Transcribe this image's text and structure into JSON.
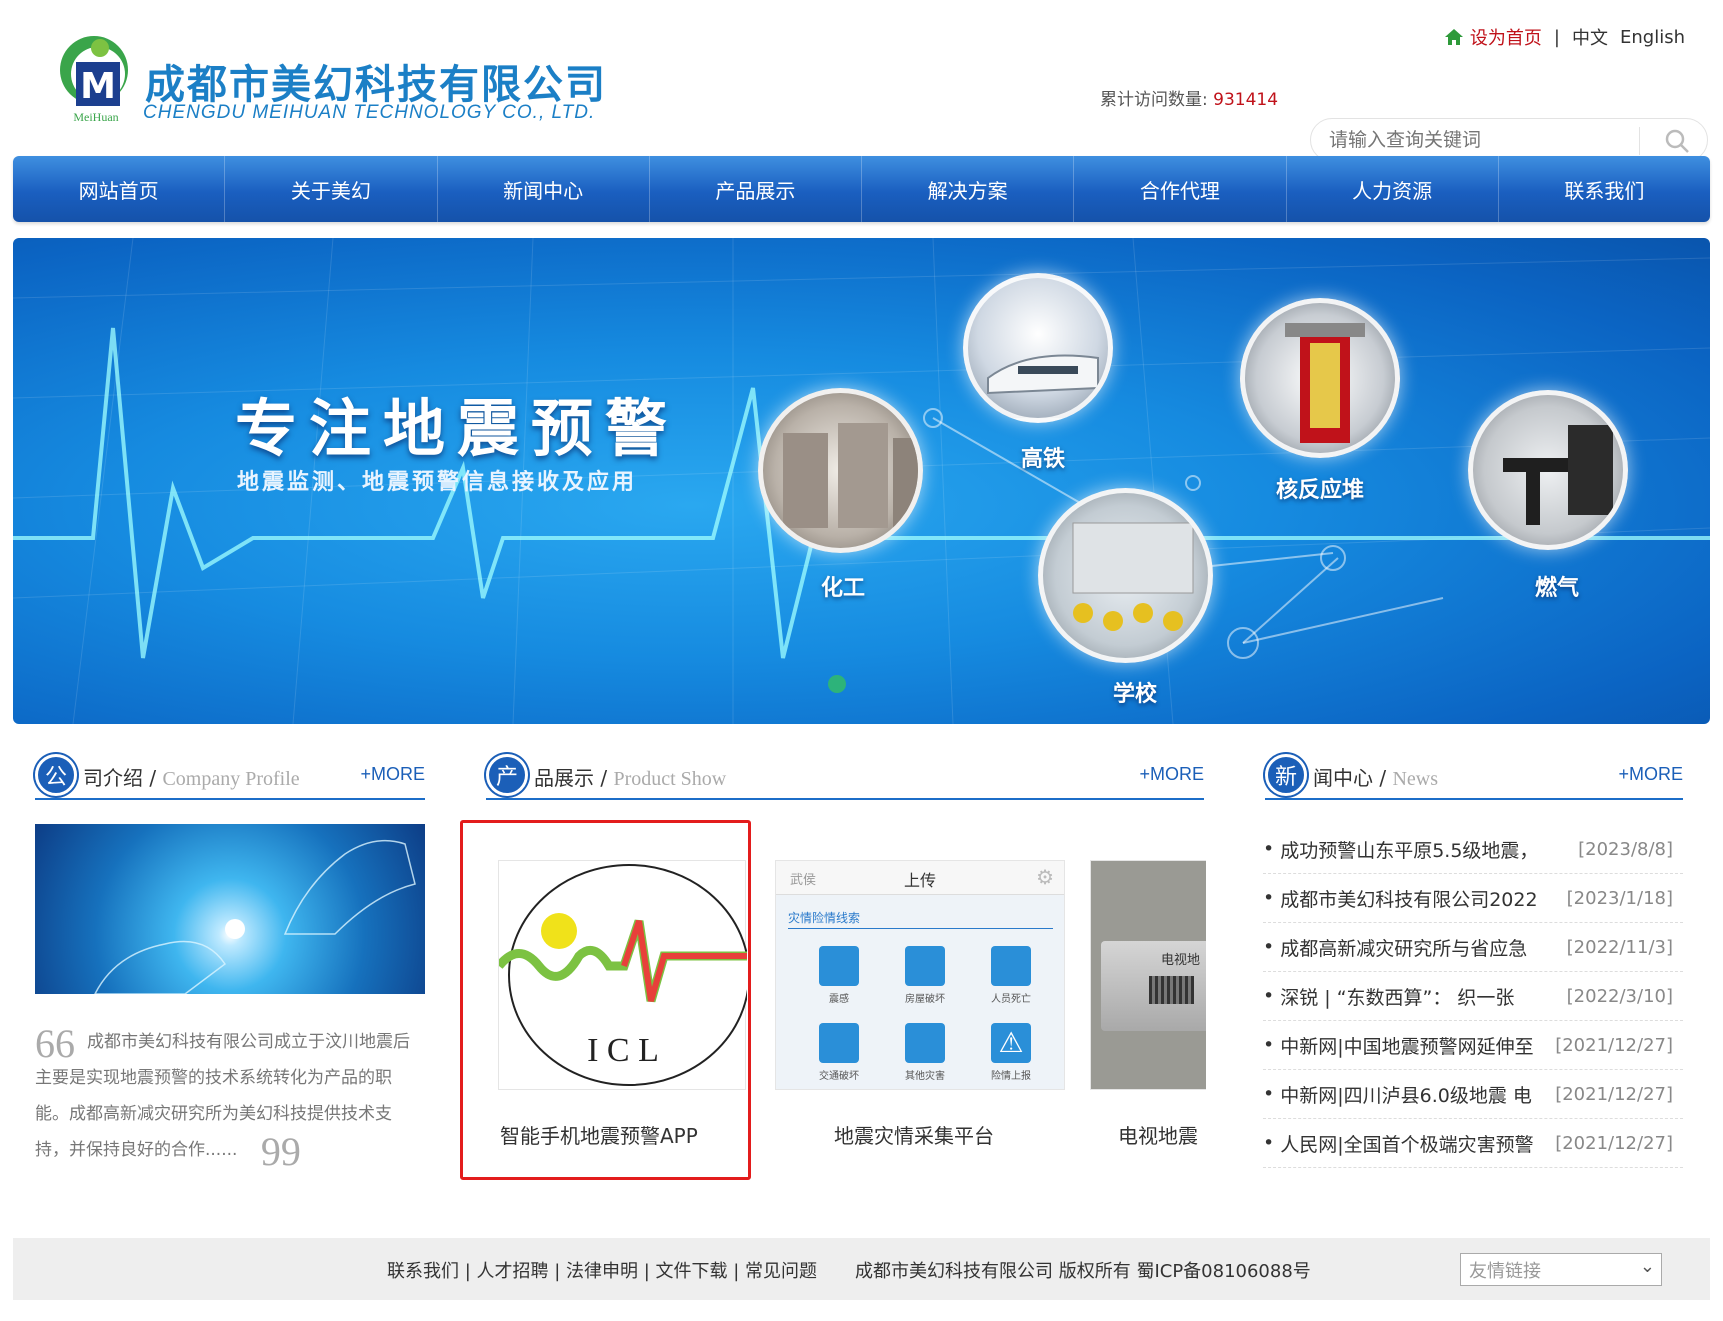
{
  "header": {
    "company_cn": "成都市美幻科技有限公司",
    "company_en": "CHENGDU MEIHUAN TECHNOLOGY CO., LTD.",
    "logo_text": "MeiHuan",
    "set_home": "设为首页",
    "divider": "|",
    "lang_cn": "中文",
    "lang_en": "English",
    "visits_label": "累计访问数量:",
    "visits_value": "931414",
    "search_placeholder": "请输入查询关键词"
  },
  "nav": [
    "网站首页",
    "关于美幻",
    "新闻中心",
    "产品展示",
    "解决方案",
    "合作代理",
    "人力资源",
    "联系我们"
  ],
  "banner": {
    "title": "专注地震预警",
    "subtitle": "地震监测、地震预警信息接收及应用",
    "bubbles": [
      "高铁",
      "核反应堆",
      "化工",
      "学校",
      "燃气"
    ]
  },
  "company": {
    "head_char": "公",
    "title": "司介绍",
    "slash": " / ",
    "title_en": "Company Profile",
    "more": "+MORE",
    "quote_open": "66",
    "quote_close": "99",
    "text": "成都市美幻科技有限公司成立于汶川地震后主要是实现地震预警的技术系统转化为产品的职能。成都高新减灾研究所为美幻科技提供技术支持，并保持良好的合作......"
  },
  "products": {
    "head_char": "产",
    "title": "品展示",
    "slash": " / ",
    "title_en": "Product Show",
    "more": "+MORE",
    "items": [
      {
        "label": "智能手机地震预警APP",
        "logo_letters": "I C L"
      },
      {
        "label": "地震灾情采集平台",
        "screen_title": "上传",
        "screen_left": "武侯",
        "screen_section": "灾情险情线索",
        "tiles": [
          "震感",
          "房屋破坏",
          "人员死亡",
          "交通破坏",
          "其他灾害",
          "险情上报"
        ]
      },
      {
        "label": "电视地震",
        "device_text": "电视地"
      }
    ]
  },
  "news": {
    "head_char": "新",
    "title": "闻中心",
    "slash": " / ",
    "title_en": "News",
    "more": "+MORE",
    "items": [
      {
        "title": "成功预警山东平原5.5级地震，",
        "date": "[2023/8/8]"
      },
      {
        "title": "成都市美幻科技有限公司2022",
        "date": "[2023/1/18]"
      },
      {
        "title": "成都高新减灾研究所与省应急",
        "date": "[2022/11/3]"
      },
      {
        "title": "深锐 | “东数西算”：  织一张",
        "date": "[2022/3/10]"
      },
      {
        "title": "中新网|中国地震预警网延伸至",
        "date": "[2021/12/27]"
      },
      {
        "title": "中新网|四川泸县6.0级地震 电",
        "date": "[2021/12/27]"
      },
      {
        "title": "人民网|全国首个极端灾害预警",
        "date": "[2021/12/27]"
      }
    ]
  },
  "footer": {
    "links": "联系我们 | 人才招聘 | 法律申明 | 文件下载 | 常见问题",
    "copyright": "成都市美幻科技有限公司  版权所有  蜀ICP备08106088号",
    "friend_links": "友情链接"
  },
  "colors": {
    "brand_blue": "#1b5fb8",
    "accent_red": "#c0121a",
    "highlight_red": "#e31c1c"
  }
}
